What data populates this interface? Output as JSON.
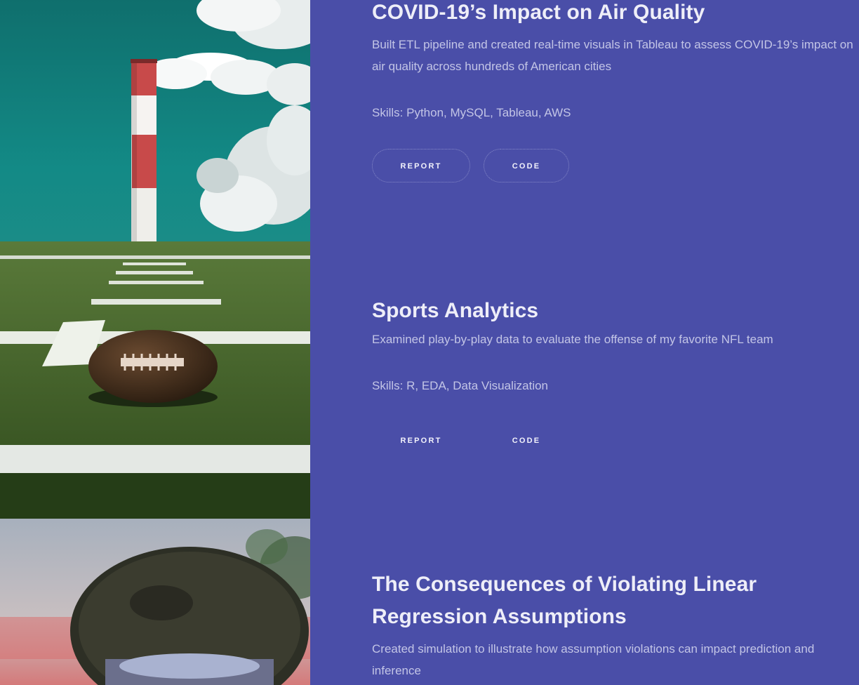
{
  "projects": [
    {
      "title": "COVID-19’s Impact on Air Quality",
      "description": "Built ETL pipeline and created real-time visuals in Tableau to assess COVID-19’s impact on air quality across hundreds of American cities",
      "skills": "Skills: Python, MySQL, Tableau, AWS",
      "report_label": "REPORT",
      "code_label": "CODE"
    },
    {
      "title": "Sports Analytics",
      "description": "Examined play-by-play data to evaluate the offense of my favorite NFL team",
      "skills": "Skills: R, EDA, Data Visualization",
      "report_label": "REPORT",
      "code_label": "CODE"
    },
    {
      "title": "The Consequences of Violating Linear Regression Assumptions",
      "description": "Created simulation to illustrate how assumption violations can impact prediction and inference"
    }
  ],
  "colors": {
    "background": "#4a4ea8",
    "title": "#eeeef8",
    "body_text": "#c3c5e6"
  },
  "images": [
    {
      "icon": "smokestack-image"
    },
    {
      "icon": "football-field-image"
    },
    {
      "icon": "crystal-ball-image"
    }
  ]
}
